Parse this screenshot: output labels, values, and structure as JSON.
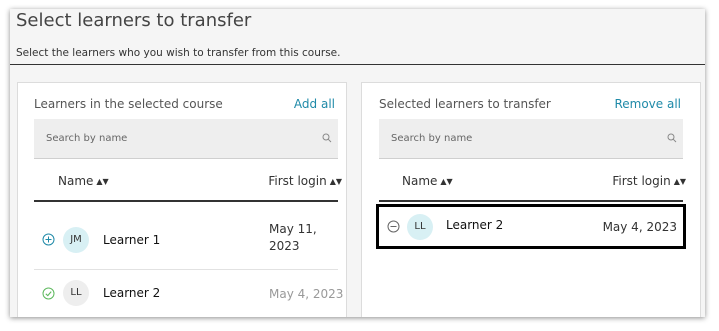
{
  "page": {
    "title": "Select learners to transfer",
    "subtitle": "Select the learners who you wish to transfer from this course."
  },
  "left_panel": {
    "title": "Learners in the selected course",
    "action": "Add all",
    "search_placeholder": "Search by name",
    "columns": [
      "Name",
      "First login"
    ],
    "rows": [
      {
        "icon": "add-circle-icon",
        "initials": "JM",
        "name": "Learner 1",
        "first_login_line1": "May 11,",
        "first_login_line2": "2023",
        "avatar_color": "#d8f0f4"
      },
      {
        "icon": "check-circle-icon",
        "initials": "LL",
        "name": "Learner 2",
        "first_login": "May 4, 2023",
        "avatar_color": "#eeeeee"
      }
    ]
  },
  "right_panel": {
    "title": "Selected learners to transfer",
    "action": "Remove all",
    "search_placeholder": "Search by name",
    "columns": [
      "Name",
      "First login"
    ],
    "rows": [
      {
        "icon": "remove-circle-icon",
        "initials": "LL",
        "name": "Learner 2",
        "first_login": "May 4, 2023",
        "avatar_color": "#d8f0f4"
      }
    ]
  },
  "colors": {
    "accent": "#1f8aa8",
    "add_icon": "#1f8aa8",
    "check_icon": "#5cb85c",
    "remove_icon": "#666666",
    "highlight_border": "#000000"
  }
}
